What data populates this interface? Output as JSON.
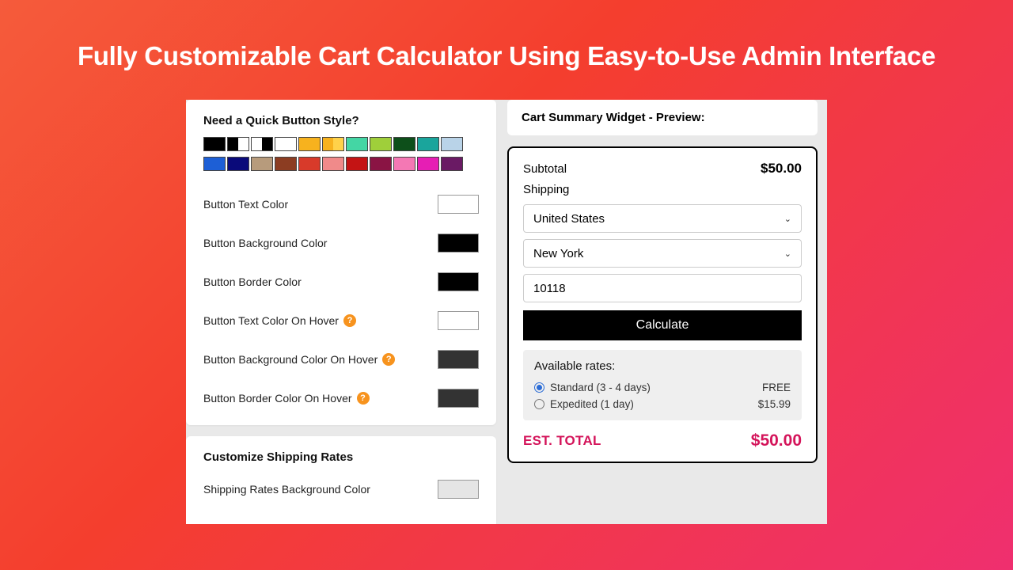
{
  "title": "Fully Customizable Cart Calculator Using Easy-to-Use Admin Interface",
  "quick_styles_title": "Need a Quick Button Style?",
  "swatches": {
    "row1": [
      [
        "#000000",
        "#000000"
      ],
      [
        "#000000",
        "#ffffff"
      ],
      [
        "#ffffff",
        "#000000"
      ],
      [
        "#ffffff",
        "#ffffff"
      ],
      [
        "#f7b21e",
        "#f7b21e"
      ],
      [
        "#f7b21e",
        "#ffd24a"
      ],
      [
        "#44d6a4",
        "#44d6a4"
      ],
      [
        "#9fcf3a",
        "#9fcf3a"
      ],
      [
        "#0d4f1a",
        "#0d4f1a"
      ],
      [
        "#1aa59c",
        "#1aa59c"
      ],
      [
        "#b9d3e8",
        "#b9d3e8"
      ]
    ],
    "row2": [
      [
        "#1d5fd6",
        "#1d5fd6"
      ],
      [
        "#0a0a7a",
        "#0a0a7a"
      ],
      [
        "#b79b7c",
        "#b79b7c"
      ],
      [
        "#8c3d22",
        "#8c3d22"
      ],
      [
        "#d83a2a",
        "#d83a2a"
      ],
      [
        "#f08a8a",
        "#f08a8a"
      ],
      [
        "#c41414",
        "#c41414"
      ],
      [
        "#8a1444",
        "#8a1444"
      ],
      [
        "#f478b4",
        "#f478b4"
      ],
      [
        "#e61eb4",
        "#e61eb4"
      ],
      [
        "#6a1a64",
        "#6a1a64"
      ]
    ]
  },
  "color_fields": [
    {
      "label": "Button Text Color",
      "value": "#ffffff",
      "help": false
    },
    {
      "label": "Button Background Color",
      "value": "#000000",
      "help": false
    },
    {
      "label": "Button Border Color",
      "value": "#000000",
      "help": false
    },
    {
      "label": "Button Text Color On Hover",
      "value": "#ffffff",
      "help": true
    },
    {
      "label": "Button Background Color On Hover",
      "value": "#333333",
      "help": true
    },
    {
      "label": "Button Border Color On Hover",
      "value": "#333333",
      "help": true
    }
  ],
  "shipping_section": {
    "title": "Customize Shipping Rates",
    "field_label": "Shipping Rates Background Color",
    "field_value": "#e5e5e5"
  },
  "preview": {
    "header": "Cart Summary Widget - Preview:",
    "subtotal_label": "Subtotal",
    "subtotal_value": "$50.00",
    "shipping_label": "Shipping",
    "country": "United States",
    "region": "New York",
    "postal": "10118",
    "calc_label": "Calculate",
    "rates_title": "Available rates:",
    "rates": [
      {
        "name": "Standard (3 - 4 days)",
        "price": "FREE",
        "selected": true
      },
      {
        "name": "Expedited (1 day)",
        "price": "$15.99",
        "selected": false
      }
    ],
    "est_label": "EST. TOTAL",
    "est_value": "$50.00"
  }
}
